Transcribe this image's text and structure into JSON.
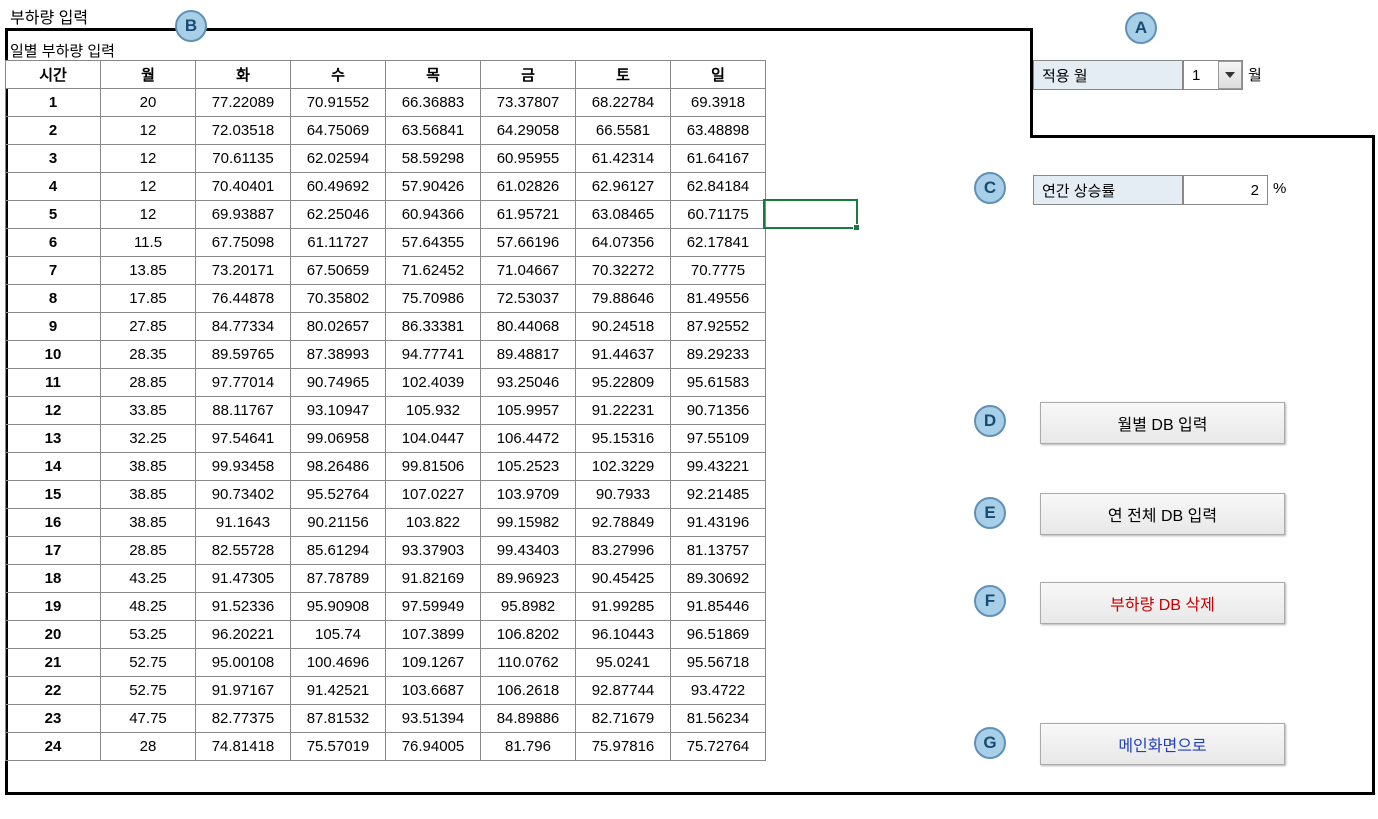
{
  "title": "부하량 입력",
  "subtitle": "일별 부하량 입력",
  "headers": [
    "시간",
    "월",
    "화",
    "수",
    "목",
    "금",
    "토",
    "일"
  ],
  "rows": [
    {
      "hour": "1",
      "values": [
        "20",
        "77.22089",
        "70.91552",
        "66.36883",
        "73.37807",
        "68.22784",
        "69.3918"
      ]
    },
    {
      "hour": "2",
      "values": [
        "12",
        "72.03518",
        "64.75069",
        "63.56841",
        "64.29058",
        "66.5581",
        "63.48898"
      ]
    },
    {
      "hour": "3",
      "values": [
        "12",
        "70.61135",
        "62.02594",
        "58.59298",
        "60.95955",
        "61.42314",
        "61.64167"
      ]
    },
    {
      "hour": "4",
      "values": [
        "12",
        "70.40401",
        "60.49692",
        "57.90426",
        "61.02826",
        "62.96127",
        "62.84184"
      ]
    },
    {
      "hour": "5",
      "values": [
        "12",
        "69.93887",
        "62.25046",
        "60.94366",
        "61.95721",
        "63.08465",
        "60.71175"
      ]
    },
    {
      "hour": "6",
      "values": [
        "11.5",
        "67.75098",
        "61.11727",
        "57.64355",
        "57.66196",
        "64.07356",
        "62.17841"
      ]
    },
    {
      "hour": "7",
      "values": [
        "13.85",
        "73.20171",
        "67.50659",
        "71.62452",
        "71.04667",
        "70.32272",
        "70.7775"
      ]
    },
    {
      "hour": "8",
      "values": [
        "17.85",
        "76.44878",
        "70.35802",
        "75.70986",
        "72.53037",
        "79.88646",
        "81.49556"
      ]
    },
    {
      "hour": "9",
      "values": [
        "27.85",
        "84.77334",
        "80.02657",
        "86.33381",
        "80.44068",
        "90.24518",
        "87.92552"
      ]
    },
    {
      "hour": "10",
      "values": [
        "28.35",
        "89.59765",
        "87.38993",
        "94.77741",
        "89.48817",
        "91.44637",
        "89.29233"
      ]
    },
    {
      "hour": "11",
      "values": [
        "28.85",
        "97.77014",
        "90.74965",
        "102.4039",
        "93.25046",
        "95.22809",
        "95.61583"
      ]
    },
    {
      "hour": "12",
      "values": [
        "33.85",
        "88.11767",
        "93.10947",
        "105.932",
        "105.9957",
        "91.22231",
        "90.71356"
      ]
    },
    {
      "hour": "13",
      "values": [
        "32.25",
        "97.54641",
        "99.06958",
        "104.0447",
        "106.4472",
        "95.15316",
        "97.55109"
      ]
    },
    {
      "hour": "14",
      "values": [
        "38.85",
        "99.93458",
        "98.26486",
        "99.81506",
        "105.2523",
        "102.3229",
        "99.43221"
      ]
    },
    {
      "hour": "15",
      "values": [
        "38.85",
        "90.73402",
        "95.52764",
        "107.0227",
        "103.9709",
        "90.7933",
        "92.21485"
      ]
    },
    {
      "hour": "16",
      "values": [
        "38.85",
        "91.1643",
        "90.21156",
        "103.822",
        "99.15982",
        "92.78849",
        "91.43196"
      ]
    },
    {
      "hour": "17",
      "values": [
        "28.85",
        "82.55728",
        "85.61294",
        "93.37903",
        "99.43403",
        "83.27996",
        "81.13757"
      ]
    },
    {
      "hour": "18",
      "values": [
        "43.25",
        "91.47305",
        "87.78789",
        "91.82169",
        "89.96923",
        "90.45425",
        "89.30692"
      ]
    },
    {
      "hour": "19",
      "values": [
        "48.25",
        "91.52336",
        "95.90908",
        "97.59949",
        "95.8982",
        "91.99285",
        "91.85446"
      ]
    },
    {
      "hour": "20",
      "values": [
        "53.25",
        "96.20221",
        "105.74",
        "107.3899",
        "106.8202",
        "96.10443",
        "96.51869"
      ]
    },
    {
      "hour": "21",
      "values": [
        "52.75",
        "95.00108",
        "100.4696",
        "109.1267",
        "110.0762",
        "95.0241",
        "95.56718"
      ]
    },
    {
      "hour": "22",
      "values": [
        "52.75",
        "91.97167",
        "91.42521",
        "103.6687",
        "106.2618",
        "92.87744",
        "93.4722"
      ]
    },
    {
      "hour": "23",
      "values": [
        "47.75",
        "82.77375",
        "87.81532",
        "93.51394",
        "84.89886",
        "82.71679",
        "81.56234"
      ]
    },
    {
      "hour": "24",
      "values": [
        "28",
        "74.81418",
        "75.57019",
        "76.94005",
        "81.796",
        "75.97816",
        "75.72764"
      ]
    }
  ],
  "month_label": "적용 월",
  "month_value": "1",
  "month_unit": "월",
  "rate_label": "연간 상승률",
  "rate_value": "2",
  "rate_unit": "%",
  "buttons": {
    "monthly": "월별 DB 입력",
    "yearly": "연 전체 DB 입력",
    "delete": "부하량 DB 삭제",
    "main": "메인화면으로"
  },
  "markers": {
    "a": "A",
    "b": "B",
    "c": "C",
    "d": "D",
    "e": "E",
    "f": "F",
    "g": "G"
  }
}
